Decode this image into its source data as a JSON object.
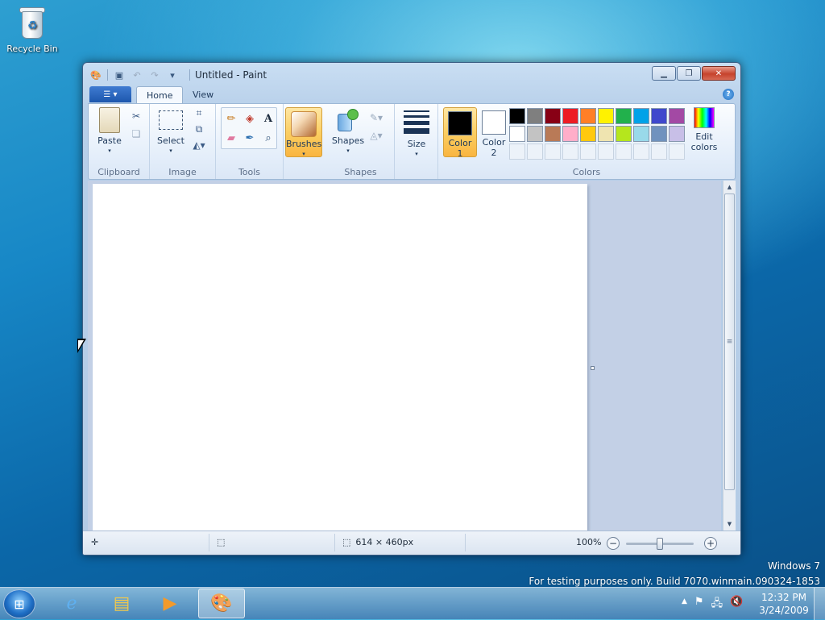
{
  "desktop": {
    "recycle_bin_label": "Recycle Bin",
    "watermark_line1": "Windows 7",
    "watermark_line2": "For testing purposes only. Build 7070.winmain.090324-1853"
  },
  "window": {
    "title": "Untitled - Paint",
    "tabs": [
      {
        "label": "Home"
      },
      {
        "label": "View"
      }
    ],
    "active_tab": "Home"
  },
  "ribbon": {
    "clipboard": {
      "paste_label": "Paste",
      "group_label": "Clipboard"
    },
    "image": {
      "select_label": "Select",
      "group_label": "Image"
    },
    "tools": {
      "group_label": "Tools"
    },
    "brushes": {
      "label": "Brushes"
    },
    "shapes": {
      "shapes_label": "Shapes",
      "group_label": "Shapes"
    },
    "size": {
      "label": "Size"
    },
    "colors": {
      "color1_label": "Color",
      "color1_num": "1",
      "color2_label": "Color",
      "color2_num": "2",
      "edit_label": "Edit",
      "edit_label2": "colors",
      "group_label": "Colors",
      "color1_value": "#000000",
      "color2_value": "#ffffff",
      "palette": [
        "#000000",
        "#7f7f7f",
        "#880015",
        "#ed1c24",
        "#ff7f27",
        "#fff200",
        "#22b14c",
        "#00a2e8",
        "#3f48cc",
        "#a349a4",
        "#ffffff",
        "#c3c3c3",
        "#b97a57",
        "#ffaec9",
        "#ffc90e",
        "#efe4b0",
        "#b5e61d",
        "#99d9ea",
        "#7092be",
        "#c8bfe7"
      ]
    }
  },
  "statusbar": {
    "dimensions": "614 × 460px",
    "zoom": "100%"
  },
  "taskbar": {
    "time": "12:32 PM",
    "date": "3/24/2009"
  }
}
